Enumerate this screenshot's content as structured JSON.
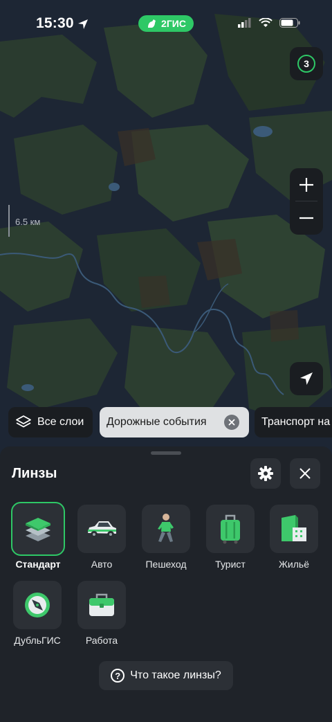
{
  "status_bar": {
    "time": "15:30",
    "brand": "2ГИС"
  },
  "map": {
    "badge_count": "3",
    "scale_label": "6.5 км",
    "zoom_in": "+",
    "zoom_out": "−"
  },
  "chips": {
    "layers": "Все слои",
    "road_events": "Дорожные события",
    "transport": "Транспорт на"
  },
  "sheet": {
    "title": "Линзы",
    "lenses": [
      {
        "label": "Стандарт",
        "icon": "layers-stack-icon",
        "selected": true
      },
      {
        "label": "Авто",
        "icon": "car-icon"
      },
      {
        "label": "Пешеход",
        "icon": "pedestrian-icon"
      },
      {
        "label": "Турист",
        "icon": "suitcase-icon"
      },
      {
        "label": "Жильё",
        "icon": "building-icon"
      },
      {
        "label": "ДубльГИС",
        "icon": "compass-icon"
      },
      {
        "label": "Работа",
        "icon": "briefcase-icon"
      }
    ],
    "help_label": "Что такое линзы?"
  },
  "colors": {
    "accent": "#2ec866",
    "panel": "#1f2329",
    "button": "#2c3036"
  }
}
